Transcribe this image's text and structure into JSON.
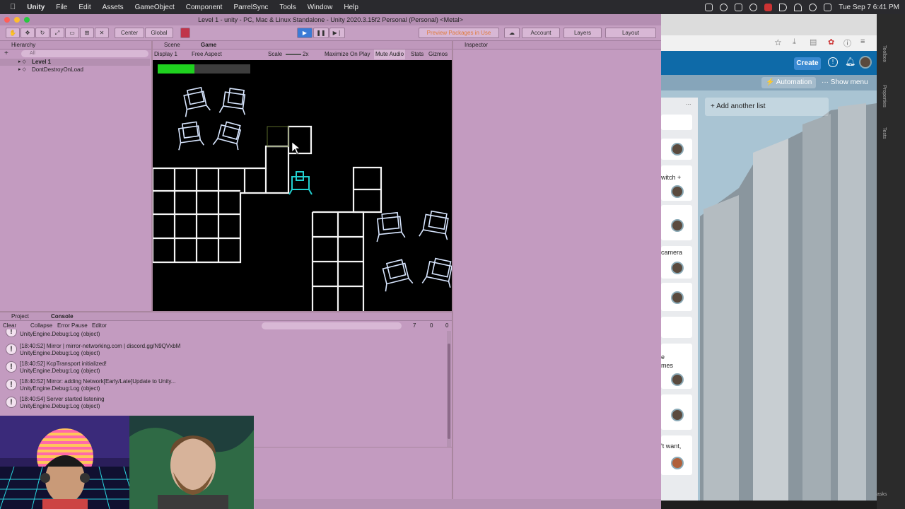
{
  "menubar": {
    "items": [
      "Unity",
      "File",
      "Edit",
      "Assets",
      "GameObject",
      "Component",
      "ParrelSync",
      "Tools",
      "Window",
      "Help"
    ],
    "datetime": "Tue Sep 7  6:41 PM"
  },
  "window": {
    "title": "Level 1 - unity - PC, Mac & Linux Standalone - Unity 2020.3.15f2 Personal (Personal) <Metal>"
  },
  "toolbar": {
    "pivot_label": "Center",
    "space_label": "Global",
    "preview_packages_label": "Preview Packages in Use",
    "account_label": "Account",
    "layers_label": "Layers",
    "layout_label": "Layout"
  },
  "hierarchy": {
    "tab_label": "Hierarchy",
    "search_placeholder": "All",
    "items": [
      "Level 1",
      "DontDestroyOnLoad"
    ]
  },
  "center_tabs": {
    "scene_label": "Scene",
    "game_label": "Game"
  },
  "game_toolbar": {
    "display_label": "Display 1",
    "aspect_label": "Free Aspect",
    "scale_label": "Scale",
    "scale_value": "2x",
    "maximize_label": "Maximize On Play",
    "mute_label": "Mute Audio",
    "stats_label": "Stats",
    "gizmos_label": "Gizmos"
  },
  "game": {
    "health_fraction": 0.4
  },
  "inspector": {
    "tab_label": "Inspector"
  },
  "bottom_tabs": {
    "project_label": "Project",
    "console_label": "Console"
  },
  "console_toolbar": {
    "clear_label": "Clear",
    "collapse_label": "Collapse",
    "error_pause_label": "Error Pause",
    "editor_label": "Editor",
    "log_count": "7",
    "warn_count": "0",
    "error_count": "0"
  },
  "console_logs": [
    {
      "line1": "UnityEngine.Debug:Log (object)",
      "line2": ""
    },
    {
      "line1": "[18:40:52] Mirror | mirror-networking.com | discord.gg/N9QVxbM",
      "line2": "UnityEngine.Debug:Log (object)"
    },
    {
      "line1": "[18:40:52] KcpTransport initialized!",
      "line2": "UnityEngine.Debug:Log (object)"
    },
    {
      "line1": "[18:40:52] Mirror: adding Network[Early/Late]Update to Unity...",
      "line2": "UnityEngine.Debug:Log (object)"
    },
    {
      "line1": "[18:40:54] Server started listening",
      "line2": "UnityEngine.Debug:Log (object)"
    }
  ],
  "browser": {
    "create_label": "Create",
    "automation_label": "Automation",
    "show_menu_label": "Show menu",
    "add_list_label": "Add another list",
    "more_label": "...",
    "card_snippets": [
      "witch +",
      "camera",
      "e",
      "mes",
      "'t want,"
    ]
  },
  "side_panel": {
    "labels": [
      "Toolbox",
      "Properties",
      "Tests"
    ],
    "footer": "asks"
  },
  "colors": {
    "unity_bg": "#c39bc0",
    "play_blue": "#3b7bd6",
    "health_green": "#1fd11f",
    "trello_blue": "#0079bf"
  }
}
